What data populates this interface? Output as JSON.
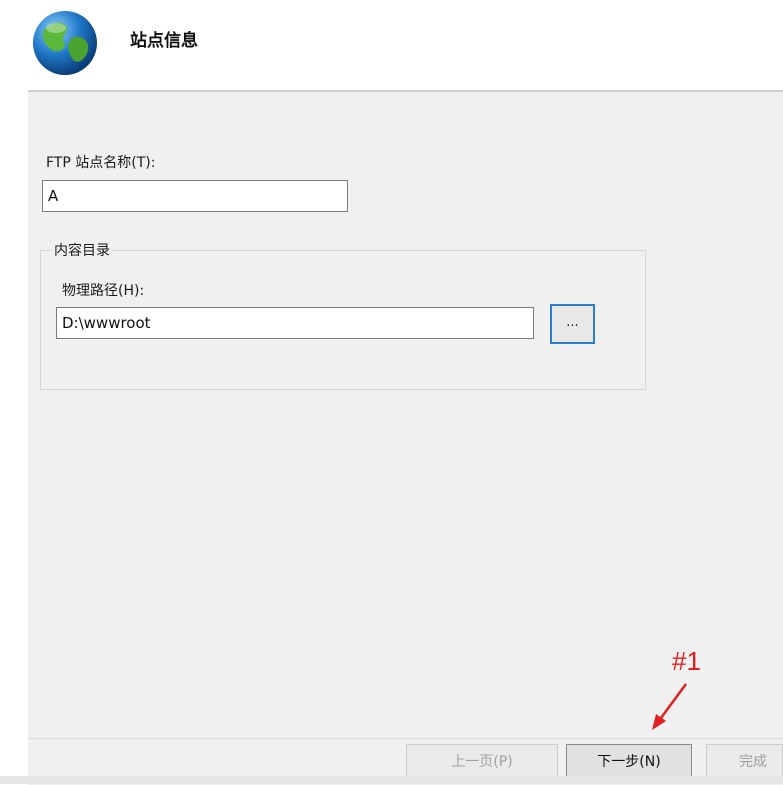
{
  "header": {
    "title": "站点信息"
  },
  "site": {
    "name_label": "FTP 站点名称(T):",
    "name_value": "A"
  },
  "content_dir": {
    "group_label": "内容目录",
    "path_label": "物理路径(H):",
    "path_value": "D:\\wwwroot",
    "browse_label": "..."
  },
  "annotation": {
    "label": "#1",
    "color": "#e02020"
  },
  "buttons": {
    "prev": "上一页(P)",
    "next": "下一步(N)",
    "finish": "完成"
  }
}
